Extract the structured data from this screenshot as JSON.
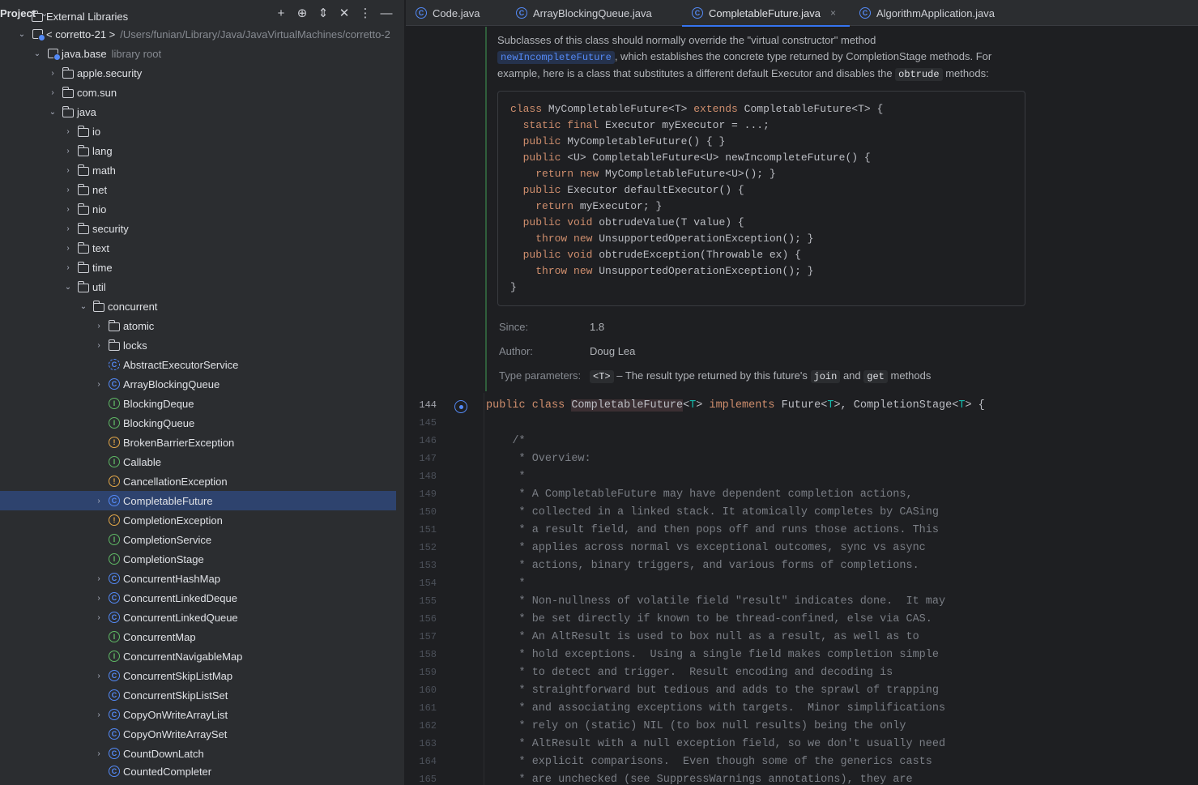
{
  "project_panel": {
    "title": "Project",
    "chevron": "⌄",
    "tools": [
      "+",
      "⊕",
      "⇕",
      "✕",
      "⋮",
      "—"
    ],
    "tree": [
      {
        "depth": 1,
        "arrow": "",
        "icon": "folder",
        "label": "External Libraries",
        "partial": true
      },
      {
        "depth": 1,
        "arrow": "⌄",
        "icon": "library",
        "label": "< corretto-21 >",
        "dim": "/Users/funian/Library/Java/JavaVirtualMachines/corretto-2"
      },
      {
        "depth": 2,
        "arrow": "⌄",
        "icon": "library",
        "label": "java.base",
        "dim": "library root"
      },
      {
        "depth": 3,
        "arrow": "›",
        "icon": "folder",
        "label": "apple.security"
      },
      {
        "depth": 3,
        "arrow": "›",
        "icon": "folder",
        "label": "com.sun"
      },
      {
        "depth": 3,
        "arrow": "⌄",
        "icon": "folder",
        "label": "java"
      },
      {
        "depth": 4,
        "arrow": "›",
        "icon": "folder",
        "label": "io"
      },
      {
        "depth": 4,
        "arrow": "›",
        "icon": "folder",
        "label": "lang"
      },
      {
        "depth": 4,
        "arrow": "›",
        "icon": "folder",
        "label": "math"
      },
      {
        "depth": 4,
        "arrow": "›",
        "icon": "folder",
        "label": "net"
      },
      {
        "depth": 4,
        "arrow": "›",
        "icon": "folder",
        "label": "nio"
      },
      {
        "depth": 4,
        "arrow": "›",
        "icon": "folder",
        "label": "security"
      },
      {
        "depth": 4,
        "arrow": "›",
        "icon": "folder",
        "label": "text"
      },
      {
        "depth": 4,
        "arrow": "›",
        "icon": "folder",
        "label": "time"
      },
      {
        "depth": 4,
        "arrow": "⌄",
        "icon": "folder",
        "label": "util"
      },
      {
        "depth": 5,
        "arrow": "⌄",
        "icon": "folder",
        "label": "concurrent"
      },
      {
        "depth": 6,
        "arrow": "›",
        "icon": "folder",
        "label": "atomic"
      },
      {
        "depth": 6,
        "arrow": "›",
        "icon": "folder",
        "label": "locks"
      },
      {
        "depth": 6,
        "arrow": "",
        "icon": "abstract",
        "label": "AbstractExecutorService"
      },
      {
        "depth": 6,
        "arrow": "›",
        "icon": "class",
        "label": "ArrayBlockingQueue"
      },
      {
        "depth": 6,
        "arrow": "",
        "icon": "iface",
        "label": "BlockingDeque"
      },
      {
        "depth": 6,
        "arrow": "",
        "icon": "iface",
        "label": "BlockingQueue"
      },
      {
        "depth": 6,
        "arrow": "",
        "icon": "exc",
        "label": "BrokenBarrierException"
      },
      {
        "depth": 6,
        "arrow": "",
        "icon": "iface",
        "label": "Callable"
      },
      {
        "depth": 6,
        "arrow": "",
        "icon": "exc",
        "label": "CancellationException"
      },
      {
        "depth": 6,
        "arrow": "›",
        "icon": "class",
        "label": "CompletableFuture",
        "selected": true
      },
      {
        "depth": 6,
        "arrow": "",
        "icon": "exc",
        "label": "CompletionException"
      },
      {
        "depth": 6,
        "arrow": "",
        "icon": "iface",
        "label": "CompletionService"
      },
      {
        "depth": 6,
        "arrow": "",
        "icon": "iface",
        "label": "CompletionStage"
      },
      {
        "depth": 6,
        "arrow": "›",
        "icon": "class",
        "label": "ConcurrentHashMap"
      },
      {
        "depth": 6,
        "arrow": "›",
        "icon": "class",
        "label": "ConcurrentLinkedDeque"
      },
      {
        "depth": 6,
        "arrow": "›",
        "icon": "class",
        "label": "ConcurrentLinkedQueue"
      },
      {
        "depth": 6,
        "arrow": "",
        "icon": "iface",
        "label": "ConcurrentMap"
      },
      {
        "depth": 6,
        "arrow": "",
        "icon": "iface",
        "label": "ConcurrentNavigableMap"
      },
      {
        "depth": 6,
        "arrow": "›",
        "icon": "class",
        "label": "ConcurrentSkipListMap"
      },
      {
        "depth": 6,
        "arrow": "",
        "icon": "class",
        "label": "ConcurrentSkipListSet"
      },
      {
        "depth": 6,
        "arrow": "›",
        "icon": "class",
        "label": "CopyOnWriteArrayList"
      },
      {
        "depth": 6,
        "arrow": "",
        "icon": "class",
        "label": "CopyOnWriteArraySet"
      },
      {
        "depth": 6,
        "arrow": "›",
        "icon": "class",
        "label": "CountDownLatch"
      },
      {
        "depth": 6,
        "arrow": "",
        "icon": "class",
        "label": "CountedCompleter",
        "partial": true
      }
    ]
  },
  "tabs": [
    {
      "label": "Code.java",
      "active": false,
      "icon": "class-icon"
    },
    {
      "label": "ArrayBlockingQueue.java",
      "active": false,
      "icon": "class-icon"
    },
    {
      "label": "CompletableFuture.java",
      "active": true,
      "icon": "class-icon",
      "close": "×"
    },
    {
      "label": "AlgorithmApplication.java",
      "active": false,
      "icon": "class-icon"
    }
  ],
  "doc": {
    "para1_a": "Subclasses of this class should normally override the \"virtual constructor\" method",
    "para1_link": "newIncompleteFuture",
    "para1_b": ", which establishes the concrete type returned by CompletionStage methods. For",
    "para1_c": "example, here is a class that substitutes a different default Executor and disables the",
    "para1_code": "obtrude",
    "para1_d": "methods:",
    "code_box": [
      [
        [
          "kw",
          "class "
        ],
        [
          "",
          "MyCompletableFuture<T> "
        ],
        [
          "kw",
          "extends "
        ],
        [
          "",
          "CompletableFuture<T> {"
        ]
      ],
      [
        [
          "",
          "  "
        ],
        [
          "kw",
          "static final "
        ],
        [
          "",
          "Executor myExecutor = ...;"
        ]
      ],
      [
        [
          "",
          "  "
        ],
        [
          "kw",
          "public "
        ],
        [
          "",
          "MyCompletableFuture() { }"
        ]
      ],
      [
        [
          "",
          "  "
        ],
        [
          "kw",
          "public "
        ],
        [
          "",
          "<U> CompletableFuture<U> newIncompleteFuture() {"
        ]
      ],
      [
        [
          "",
          "    "
        ],
        [
          "kw",
          "return new "
        ],
        [
          "",
          "MyCompletableFuture<U>(); }"
        ]
      ],
      [
        [
          "",
          "  "
        ],
        [
          "kw",
          "public "
        ],
        [
          "",
          "Executor defaultExecutor() {"
        ]
      ],
      [
        [
          "",
          "    "
        ],
        [
          "kw",
          "return "
        ],
        [
          "",
          "myExecutor; }"
        ]
      ],
      [
        [
          "",
          "  "
        ],
        [
          "kw",
          "public void "
        ],
        [
          "",
          "obtrudeValue(T value) {"
        ]
      ],
      [
        [
          "",
          "    "
        ],
        [
          "kw",
          "throw new "
        ],
        [
          "",
          "UnsupportedOperationException(); }"
        ]
      ],
      [
        [
          "",
          "  "
        ],
        [
          "kw",
          "public void "
        ],
        [
          "",
          "obtrudeException(Throwable ex) {"
        ]
      ],
      [
        [
          "",
          "    "
        ],
        [
          "kw",
          "throw new "
        ],
        [
          "",
          "UnsupportedOperationException(); }"
        ]
      ],
      [
        [
          "",
          "}"
        ]
      ]
    ],
    "since_key": "Since:",
    "since_val": "1.8",
    "author_key": "Author:",
    "author_val": "Doug Lea",
    "tparams_key": "Type parameters:",
    "tparams_code": "<T>",
    "tparams_a": "– The result type returned by this future's",
    "tparams_join": "join",
    "tparams_and": "and",
    "tparams_get": "get",
    "tparams_b": "methods"
  },
  "code_lines": [
    {
      "num": "144",
      "text": "",
      "current": true
    },
    {
      "num": "145",
      "text": ""
    },
    {
      "num": "146",
      "text": "    /*"
    },
    {
      "num": "147",
      "text": "     * Overview:"
    },
    {
      "num": "148",
      "text": "     *"
    },
    {
      "num": "149",
      "text": "     * A CompletableFuture may have dependent completion actions,"
    },
    {
      "num": "150",
      "text": "     * collected in a linked stack. It atomically completes by CASing"
    },
    {
      "num": "151",
      "text": "     * a result field, and then pops off and runs those actions. This"
    },
    {
      "num": "152",
      "text": "     * applies across normal vs exceptional outcomes, sync vs async"
    },
    {
      "num": "153",
      "text": "     * actions, binary triggers, and various forms of completions."
    },
    {
      "num": "154",
      "text": "     *"
    },
    {
      "num": "155",
      "text": "     * Non-nullness of volatile field \"result\" indicates done.  It may"
    },
    {
      "num": "156",
      "text": "     * be set directly if known to be thread-confined, else via CAS."
    },
    {
      "num": "157",
      "text": "     * An AltResult is used to box null as a result, as well as to"
    },
    {
      "num": "158",
      "text": "     * hold exceptions.  Using a single field makes completion simple"
    },
    {
      "num": "159",
      "text": "     * to detect and trigger.  Result encoding and decoding is"
    },
    {
      "num": "160",
      "text": "     * straightforward but tedious and adds to the sprawl of trapping"
    },
    {
      "num": "161",
      "text": "     * and associating exceptions with targets.  Minor simplifications"
    },
    {
      "num": "162",
      "text": "     * rely on (static) NIL (to box null results) being the only"
    },
    {
      "num": "163",
      "text": "     * AltResult with a null exception field, so we don't usually need"
    },
    {
      "num": "164",
      "text": "     * explicit comparisons.  Even though some of the generics casts"
    },
    {
      "num": "165",
      "text": "     * are unchecked (see SuppressWarnings annotations), they are"
    }
  ],
  "decl_line": {
    "kw": "public class ",
    "name": "CompletableFuture",
    "t1": "<",
    "tp1": "T",
    "t2": "> ",
    "kw2": "implements ",
    "rest1": "Future<",
    "tp2": "T",
    "rest2": ">, CompletionStage<",
    "tp3": "T",
    "rest3": "> {"
  },
  "colors": {
    "accent": "#3574f0",
    "selection": "#2e436e",
    "keyword": "#cf8e6d",
    "type_param": "#16baac"
  }
}
